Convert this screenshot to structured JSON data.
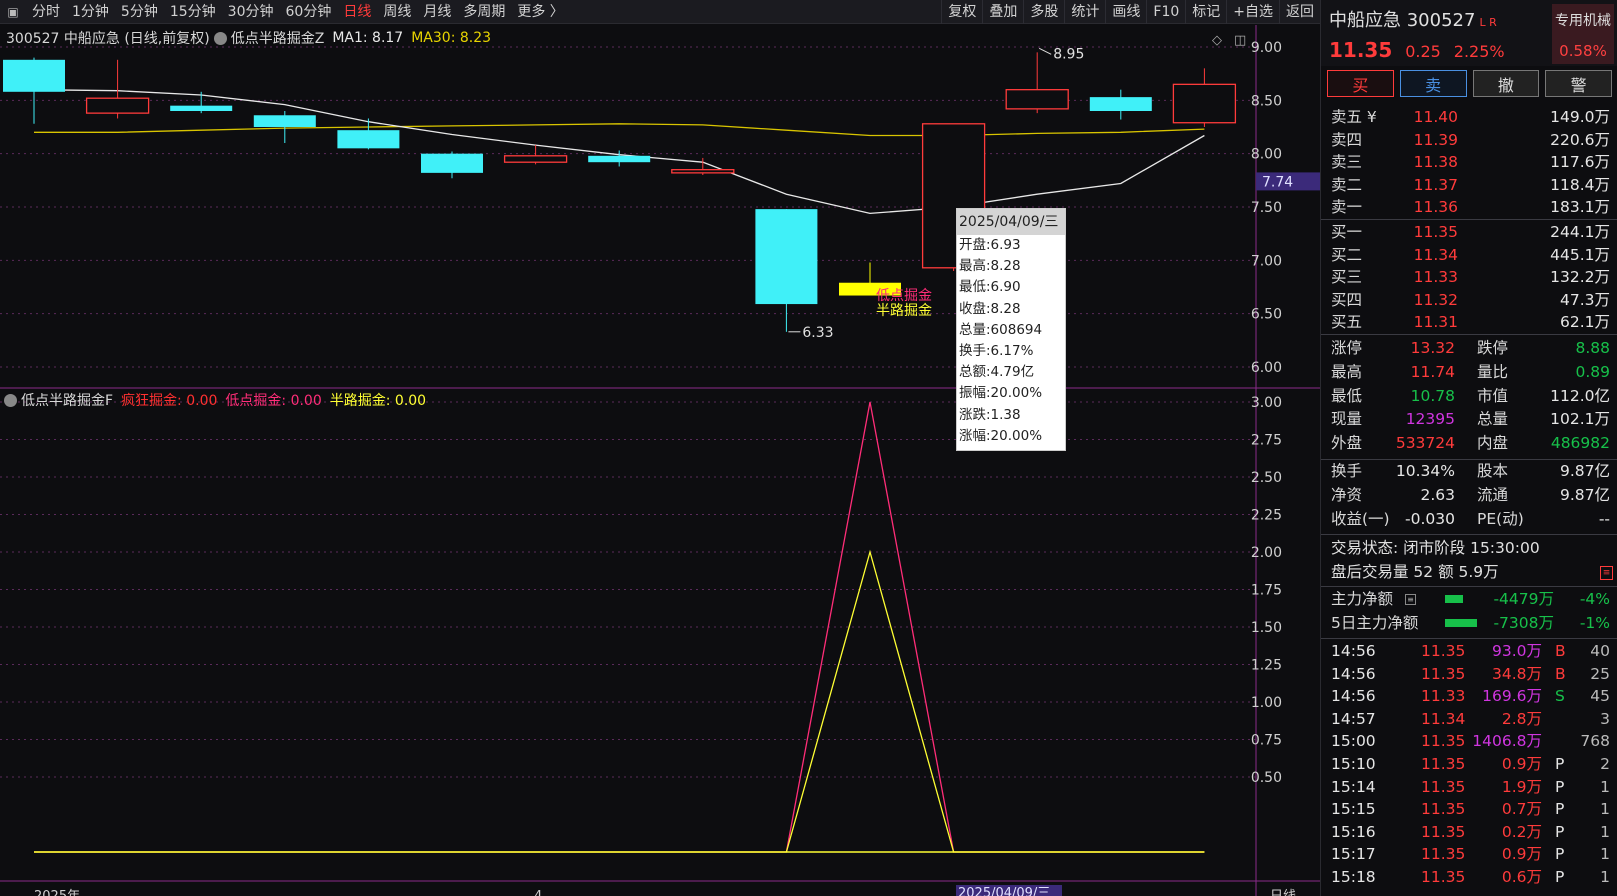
{
  "toolbar": {
    "periods": [
      "分时",
      "1分钟",
      "5分钟",
      "15分钟",
      "30分钟",
      "60分钟",
      "日线",
      "周线",
      "月线",
      "多周期",
      "更多 〉"
    ],
    "active_period": "日线",
    "tools": [
      "复权",
      "叠加",
      "多股",
      "统计",
      "画线",
      "F10",
      "标记",
      "+自选",
      "返回"
    ]
  },
  "main_chart": {
    "info": {
      "title": "300527 中船应急 (日线,前复权)",
      "indicator": "低点半路掘金Z",
      "ma1_label": "MA1: 8.17",
      "ma30_label": "MA30: 8.23"
    },
    "price_labels": [
      "9.00",
      "8.50",
      "8.00",
      "7.50",
      "7.00",
      "6.50",
      "6.00"
    ],
    "current_price_tag": "7.74",
    "annotations": {
      "high": "8.95",
      "low": "6.33",
      "signal_low": "低点掘金",
      "signal_half": "半路掘金"
    },
    "colors": {
      "up": "#ff3b3b",
      "down": "#40f0f8",
      "signal": "#ffff00",
      "ma1": "#e8e8e8",
      "ma30": "#d8c400"
    }
  },
  "sub_chart": {
    "info": {
      "indicator": "低点半路掘金F",
      "crazy_label": "疯狂掘金: 0.00",
      "low_label": "低点掘金: 0.00",
      "half_label": "半路掘金: 0.00"
    },
    "y_labels": [
      "3.00",
      "2.75",
      "2.50",
      "2.25",
      "2.00",
      "1.75",
      "1.50",
      "1.25",
      "1.00",
      "0.75",
      "0.50"
    ]
  },
  "bottom_axis": {
    "year_label": "2025年",
    "month_label": "4",
    "date_tag": "2025/04/09/三",
    "period_label": "日线"
  },
  "chart_data": {
    "type": "candlestick",
    "candles": [
      {
        "open": 8.88,
        "high": 8.9,
        "low": 8.28,
        "close": 8.58,
        "dir": "down"
      },
      {
        "open": 8.38,
        "high": 8.88,
        "low": 8.33,
        "close": 8.52,
        "dir": "up"
      },
      {
        "open": 8.45,
        "high": 8.58,
        "low": 8.38,
        "close": 8.4,
        "dir": "down"
      },
      {
        "open": 8.36,
        "high": 8.4,
        "low": 8.1,
        "close": 8.25,
        "dir": "down"
      },
      {
        "open": 8.22,
        "high": 8.33,
        "low": 8.04,
        "close": 8.05,
        "dir": "down"
      },
      {
        "open": 8.0,
        "high": 8.02,
        "low": 7.77,
        "close": 7.82,
        "dir": "down"
      },
      {
        "open": 7.92,
        "high": 8.08,
        "low": 7.9,
        "close": 7.98,
        "dir": "up"
      },
      {
        "open": 7.98,
        "high": 8.03,
        "low": 7.88,
        "close": 7.92,
        "dir": "down"
      },
      {
        "open": 7.82,
        "high": 7.96,
        "low": 7.8,
        "close": 7.85,
        "dir": "up"
      },
      {
        "open": 7.48,
        "high": 7.48,
        "low": 6.33,
        "close": 6.59,
        "dir": "down"
      },
      {
        "open": 6.79,
        "high": 6.98,
        "low": 6.67,
        "close": 6.67,
        "dir": "signal"
      },
      {
        "open": 6.93,
        "high": 8.28,
        "low": 6.9,
        "close": 8.28,
        "dir": "up"
      },
      {
        "open": 8.42,
        "high": 8.95,
        "low": 8.38,
        "close": 8.6,
        "dir": "up"
      },
      {
        "open": 8.53,
        "high": 8.6,
        "low": 8.32,
        "close": 8.4,
        "dir": "down"
      },
      {
        "open": 8.29,
        "high": 8.8,
        "low": 8.25,
        "close": 8.65,
        "dir": "up"
      }
    ],
    "ma1": [
      8.6,
      8.59,
      8.55,
      8.46,
      8.3,
      8.18,
      8.08,
      7.99,
      7.92,
      7.62,
      7.44,
      7.5,
      7.62,
      7.72,
      8.17
    ],
    "ma30": [
      8.2,
      8.2,
      8.22,
      8.24,
      8.25,
      8.26,
      8.27,
      8.28,
      8.27,
      8.22,
      8.17,
      8.17,
      8.19,
      8.2,
      8.23
    ],
    "sub_series": [
      {
        "name": "低点掘金",
        "color": "#ff2d78",
        "values": [
          0,
          0,
          0,
          0,
          0,
          0,
          0,
          0,
          0,
          0,
          3,
          0,
          0,
          0,
          0
        ]
      },
      {
        "name": "半路掘金",
        "color": "#ffff33",
        "values": [
          0,
          0,
          0,
          0,
          0,
          0,
          0,
          0,
          0,
          0,
          2,
          0,
          0,
          0,
          0
        ]
      }
    ],
    "price_range": [
      6.0,
      9.0
    ],
    "sub_range": [
      0,
      3.0
    ]
  },
  "tooltip": {
    "date": "2025/04/09/三",
    "rows": [
      "开盘:6.93",
      "最高:8.28",
      "最低:6.90",
      "收盘:8.28",
      "总量:608694",
      "换手:6.17%",
      "总额:4.79亿",
      "振幅:20.00%",
      "涨跌:1.38",
      "涨幅:20.00%"
    ]
  },
  "panel": {
    "stock_name": "中船应急 300527",
    "badge": "L R",
    "price": "11.35",
    "change": "0.25",
    "change_pct": "2.25%",
    "special_label": "专用机械",
    "special_value": "0.58%",
    "actions": [
      "买",
      "卖",
      "撤",
      "警"
    ],
    "asks": [
      {
        "label": "卖五 ¥",
        "price": "11.40",
        "vol": "149.0万"
      },
      {
        "label": "卖四",
        "price": "11.39",
        "vol": "220.6万"
      },
      {
        "label": "卖三",
        "price": "11.38",
        "vol": "117.6万"
      },
      {
        "label": "卖二",
        "price": "11.37",
        "vol": "118.4万"
      },
      {
        "label": "卖一",
        "price": "11.36",
        "vol": "183.1万"
      }
    ],
    "bids": [
      {
        "label": "买一",
        "price": "11.35",
        "vol": "244.1万"
      },
      {
        "label": "买二",
        "price": "11.34",
        "vol": "445.1万"
      },
      {
        "label": "买三",
        "price": "11.33",
        "vol": "132.2万"
      },
      {
        "label": "买四",
        "price": "11.32",
        "vol": "47.3万"
      },
      {
        "label": "买五",
        "price": "11.31",
        "vol": "62.1万"
      }
    ],
    "stats1": [
      {
        "l1": "涨停",
        "v1": "13.32",
        "c1": "red",
        "l2": "跌停",
        "v2": "8.88",
        "c2": "green"
      },
      {
        "l1": "最高",
        "v1": "11.74",
        "c1": "red",
        "l2": "量比",
        "v2": "0.89",
        "c2": "green"
      },
      {
        "l1": "最低",
        "v1": "10.78",
        "c1": "green",
        "l2": "市值",
        "v2": "112.0亿",
        "c2": "white"
      },
      {
        "l1": "现量",
        "v1": "12395",
        "c1": "magenta",
        "l2": "总量",
        "v2": "102.1万",
        "c2": "white"
      },
      {
        "l1": "外盘",
        "v1": "533724",
        "c1": "red",
        "l2": "内盘",
        "v2": "486982",
        "c2": "green"
      }
    ],
    "stats2": [
      {
        "l1": "换手",
        "v1": "10.34%",
        "c1": "white",
        "l2": "股本",
        "v2": "9.87亿",
        "c2": "white"
      },
      {
        "l1": "净资",
        "v1": "2.63",
        "c1": "white",
        "l2": "流通",
        "v2": "9.87亿",
        "c2": "white"
      },
      {
        "l1": "收益(一)",
        "v1": "-0.030",
        "c1": "white",
        "l2": "PE(动)",
        "v2": "--",
        "c2": "white"
      }
    ],
    "trade_status": "交易状态: 闭市阶段 15:30:00",
    "after_hours": "盘后交易量 52 额 5.9万",
    "main_net": {
      "label": "主力净额",
      "value": "-4479万",
      "pct": "-4%"
    },
    "main_net5": {
      "label": "5日主力净额",
      "value": "-7308万",
      "pct": "-1%"
    },
    "ticks": [
      {
        "time": "14:56",
        "price": "11.35",
        "vol": "93.0万",
        "vc": "magenta",
        "bs": "B",
        "bc": "red",
        "n": "40"
      },
      {
        "time": "14:56",
        "price": "11.35",
        "vol": "34.8万",
        "vc": "red",
        "bs": "B",
        "bc": "red",
        "n": "25"
      },
      {
        "time": "14:56",
        "price": "11.33",
        "vol": "169.6万",
        "vc": "magenta",
        "bs": "S",
        "bc": "green",
        "n": "45"
      },
      {
        "time": "14:57",
        "price": "11.34",
        "vol": "2.8万",
        "vc": "red",
        "bs": "",
        "bc": "white",
        "n": "3"
      },
      {
        "time": "15:00",
        "price": "11.35",
        "vol": "1406.8万",
        "vc": "magenta",
        "bs": "",
        "bc": "white",
        "n": "768"
      },
      {
        "time": "15:10",
        "price": "11.35",
        "vol": "0.9万",
        "vc": "red",
        "bs": "P",
        "bc": "white",
        "n": "2"
      },
      {
        "time": "15:14",
        "price": "11.35",
        "vol": "1.9万",
        "vc": "red",
        "bs": "P",
        "bc": "white",
        "n": "1"
      },
      {
        "time": "15:15",
        "price": "11.35",
        "vol": "0.7万",
        "vc": "red",
        "bs": "P",
        "bc": "white",
        "n": "1"
      },
      {
        "time": "15:16",
        "price": "11.35",
        "vol": "0.2万",
        "vc": "red",
        "bs": "P",
        "bc": "white",
        "n": "1"
      },
      {
        "time": "15:17",
        "price": "11.35",
        "vol": "0.9万",
        "vc": "red",
        "bs": "P",
        "bc": "white",
        "n": "1"
      },
      {
        "time": "15:18",
        "price": "11.35",
        "vol": "0.6万",
        "vc": "red",
        "bs": "P",
        "bc": "white",
        "n": "1"
      }
    ]
  }
}
